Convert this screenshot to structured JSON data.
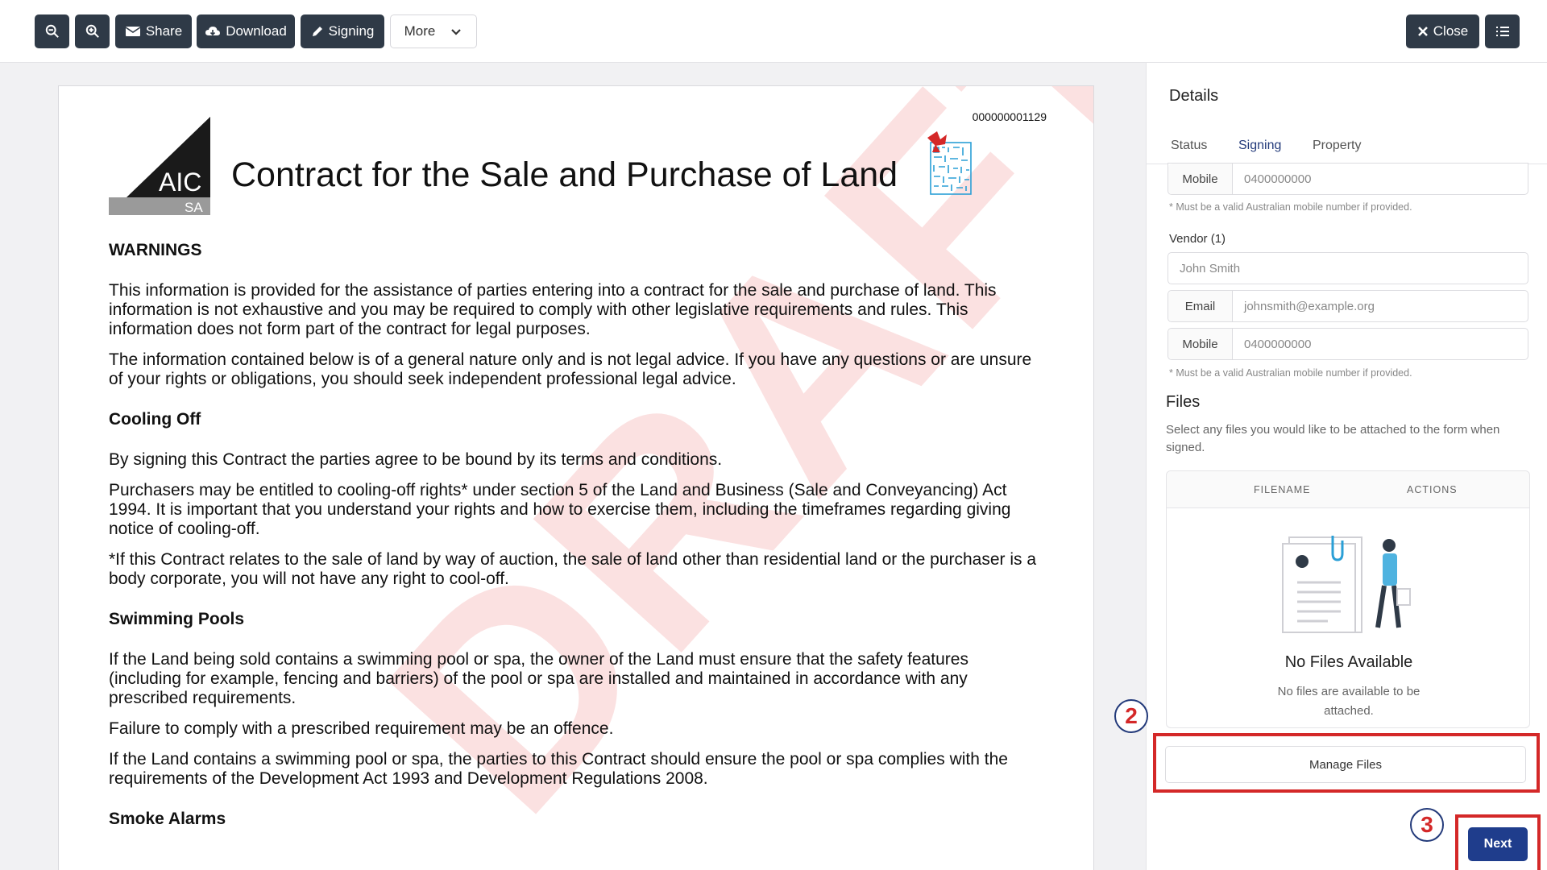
{
  "toolbar": {
    "zoom_out_label": "",
    "zoom_in_label": "",
    "share_label": "Share",
    "download_label": "Download",
    "signing_label": "Signing",
    "more_label": "More",
    "close_label": "Close"
  },
  "document": {
    "id_number": "000000001129",
    "logo_text": "AIC",
    "logo_sub": "SA",
    "title": "Contract for the Sale and Purchase of Land",
    "watermark": "DRAFT",
    "sections": [
      {
        "heading": "WARNINGS",
        "paragraphs": [
          "This information is provided for the assistance of parties entering into a contract for the sale and purchase of land. This information is not exhaustive and you may be required to comply with other legislative requirements and rules. This information does not form part of the contract for legal purposes.",
          "The information contained below is of a general nature only and is not legal advice.  If you have any questions or are unsure of your rights or obligations, you should seek independent professional legal advice."
        ]
      },
      {
        "heading": "Cooling Off",
        "paragraphs": [
          "By signing this Contract the parties agree to be bound by its terms and conditions.",
          "Purchasers may be entitled to cooling-off rights* under section 5 of the Land and Business (Sale and Conveyancing) Act 1994. It is important that you understand your rights and how to exercise them, including the timeframes regarding giving notice of cooling-off.",
          "*If this Contract relates to the sale of land by way of auction, the sale of land other than residential land or the purchaser is a body corporate, you will not have any right to cool-off."
        ]
      },
      {
        "heading": "Swimming Pools",
        "paragraphs": [
          "If the Land being sold contains a swimming pool or spa, the owner of the Land must ensure that the safety features (including for example, fencing and barriers) of the pool or spa are installed and maintained in accordance with any prescribed requirements.",
          "Failure to comply with a prescribed requirement may be an offence.",
          "If the Land contains a swimming pool or spa, the parties to this Contract should ensure the pool or spa complies with the requirements of the Development Act 1993 and Development Regulations 2008."
        ]
      },
      {
        "heading": "Smoke Alarms",
        "paragraphs": []
      }
    ]
  },
  "panel": {
    "title": "Details",
    "tabs": [
      "Status",
      "Signing",
      "Property"
    ],
    "active_tab": "Signing",
    "purchaser_mobile": {
      "prefix": "Mobile",
      "placeholder": "0400000000"
    },
    "mobile_hint": "* Must be a valid Australian mobile number if provided.",
    "vendor_label": "Vendor (1)",
    "vendor_name_placeholder": "John Smith",
    "vendor_email": {
      "prefix": "Email",
      "placeholder": "johnsmith@example.org"
    },
    "vendor_mobile": {
      "prefix": "Mobile",
      "placeholder": "0400000000"
    },
    "vendor_hint": "* Must be a valid Australian mobile number if provided.",
    "files_title": "Files",
    "files_desc": "Select any files you would like to be attached to the form when signed.",
    "table_headers": [
      "FILENAME",
      "ACTIONS"
    ],
    "empty_title": "No Files Available",
    "empty_desc": "No files are available to be attached.",
    "manage_files_label": "Manage Files",
    "next_label": "Next"
  },
  "annotations": {
    "step2": "2",
    "step3": "3",
    "highlight_color": "#d42828"
  },
  "colors": {
    "toolbar_button": "#2f3a47",
    "accent": "#1f3d8c",
    "watermark": "#e42828"
  }
}
